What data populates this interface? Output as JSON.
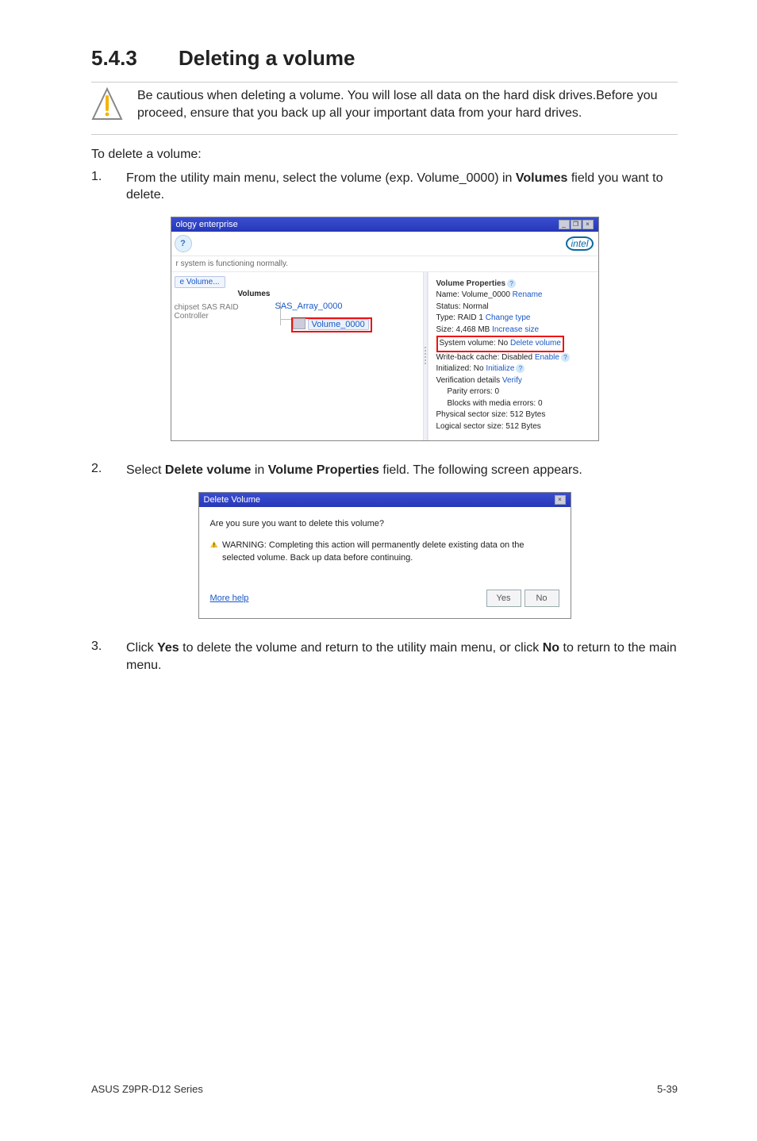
{
  "heading": {
    "num": "5.4.3",
    "title": "Deleting a volume"
  },
  "note": "Be cautious when deleting a volume. You will lose all data on the hard disk drives.Before you proceed, ensure that you back up all your important data from your hard drives.",
  "intro": "To delete a volume:",
  "steps": {
    "s1_num": "1.",
    "s1_a": "From the utility main menu, select the volume (exp. Volume_0000) in ",
    "s1_b": "Volumes",
    "s1_c": " field you want to delete.",
    "s2_num": "2.",
    "s2_a": "Select ",
    "s2_b": "Delete volume",
    "s2_c": " in ",
    "s2_d": "Volume Properties",
    "s2_e": " field. The following screen appears.",
    "s3_num": "3.",
    "s3_a": "Click ",
    "s3_b": "Yes",
    "s3_c": " to delete the volume and return to the utility main menu, or click ",
    "s3_d": "No",
    "s3_e": " to return to the main menu."
  },
  "win1": {
    "title": "ology enterprise",
    "brand": "intel",
    "status": "r system is functioning normally.",
    "left": {
      "create_volume": "e Volume...",
      "volumes_lbl": "Volumes",
      "controller": "chipset SAS RAID Controller",
      "array": "SAS_Array_0000",
      "volume": "Volume_0000"
    },
    "right": {
      "hdr": "Volume Properties",
      "name_lbl": "Name: Volume_0000 ",
      "rename": "Rename",
      "status": "Status: Normal",
      "type_lbl": "Type: RAID 1 ",
      "change_type": "Change type",
      "size_lbl": "Size: 4,468 MB ",
      "inc_size": "Increase size",
      "sys_lbl": "System volume: No ",
      "del_vol": "Delete volume",
      "wb_lbl": "Write-back cache: Disabled ",
      "enable": "Enable",
      "init_lbl": "Initialized: No ",
      "initialize": "Initialize",
      "ver_lbl": "Verification details ",
      "verify": "Verify",
      "parity": "Parity errors: 0",
      "blocks": "Blocks with media errors: 0",
      "phys": "Physical sector size: 512 Bytes",
      "log": "Logical sector size: 512 Bytes"
    },
    "winbtns": {
      "min": "_",
      "max": "❐",
      "close": "×"
    }
  },
  "win2": {
    "title": "Delete Volume",
    "close": "×",
    "q": "Are you sure you want to delete this volume?",
    "warn": "WARNING: Completing this action will permanently delete existing data on the selected volume. Back up data before continuing.",
    "more": "More help",
    "yes": "Yes",
    "no": "No"
  },
  "footer": {
    "left": "ASUS Z9PR-D12 Series",
    "right": "5-39"
  }
}
